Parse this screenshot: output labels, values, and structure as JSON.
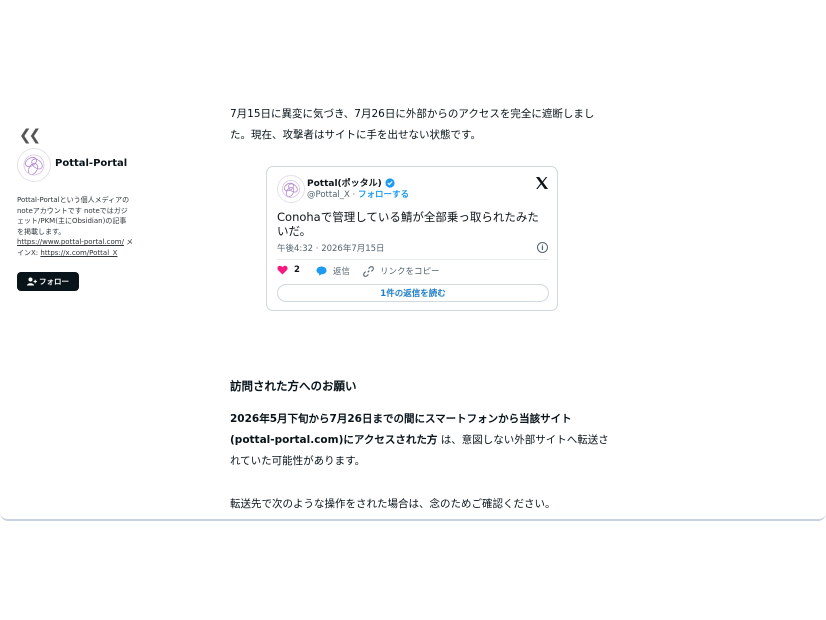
{
  "sidebar": {
    "author_name": "Pottal-Portal",
    "bio_lines": [
      "Pottal-Portalという個人メディアの",
      "noteアカウントです noteではガジ",
      "ェット/PKM(主にObsidian)の記事",
      "を掲載します。"
    ],
    "website_link": "https://www.pottal-portal.com/",
    "website_suffix": " メ",
    "x_prefix": "インX: ",
    "x_link": "https://x.com/Pottal_X",
    "follow_label": "フォロー"
  },
  "article": {
    "para1_line1": "7月15日に異変に気づき、7月26日に外部からのアクセスを完全に遮断しまし",
    "para1_line2": "た。現在、攻撃者はサイトに手を出せない状態です。",
    "heading": "訪問された方へのお願い",
    "para2_bold_line1": "2026年5月下旬から7月26日までの間にスマートフォンから当該サイト",
    "para2_bold_line2": "(pottal-portal.com)にアクセスされた方",
    "para2_rest_line2": " は、意図しない外部サイトへ転送さ",
    "para2_line3": "れていた可能性があります。",
    "para3": "転送先で次のような操作をされた場合は、念のためご確認ください。"
  },
  "tweet": {
    "name": "Pottal(ポッタル)",
    "handle": "@Pottal_X",
    "separator": " · ",
    "follow_label": "フォローする",
    "text_line1": "Conohaで管理している鯖が全部乗っ取られたみた",
    "text_line2": "いだ。",
    "timestamp": "午後4:32 · 2026年7月15日",
    "like_count": "2",
    "reply_label": "返信",
    "copy_link_label": "リンクをコピー",
    "read_replies_label": "1件の返信を読む"
  },
  "colors": {
    "accent_blue": "#1d9bf0",
    "like_pink": "#f91880",
    "dark": "#08131a"
  }
}
